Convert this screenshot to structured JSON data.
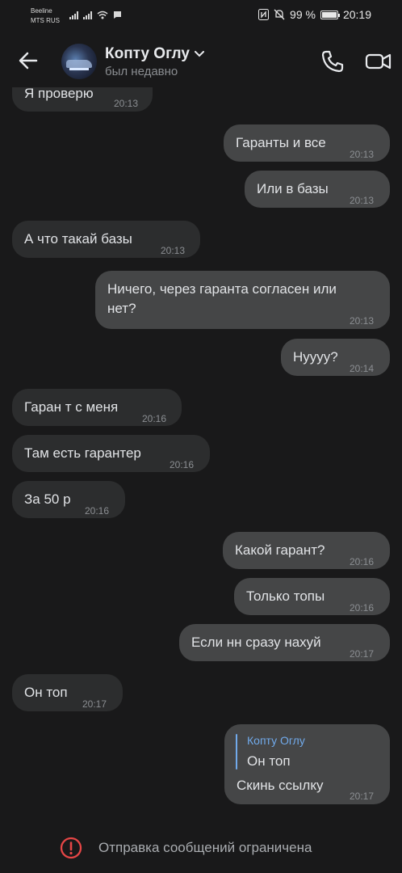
{
  "status_bar": {
    "carrier_1": "Beeline",
    "carrier_2": "MTS RUS",
    "battery": "99 %",
    "battery_level": 0.99,
    "time": "20:19"
  },
  "header": {
    "contact_name": "Копту Оглу",
    "last_seen": "был недавно"
  },
  "messages": [
    {
      "direction": "in",
      "text": "Я проверю",
      "time": "20:13"
    },
    {
      "direction": "out",
      "text": "Гаранты и все",
      "time": "20:13"
    },
    {
      "direction": "out",
      "text": "Или в базы",
      "time": "20:13"
    },
    {
      "direction": "in",
      "text": "А что такай базы",
      "time": "20:13"
    },
    {
      "direction": "out",
      "text_line_1": "Ничего, через гаранта согласен или",
      "text_line_2": "нет?",
      "time": "20:13"
    },
    {
      "direction": "out",
      "text": "Нуууу?",
      "time": "20:14"
    },
    {
      "direction": "in",
      "text": "Гаран т с меня",
      "time": "20:16"
    },
    {
      "direction": "in",
      "text": "Там есть гарантер",
      "time": "20:16"
    },
    {
      "direction": "in",
      "text": "За 50 р",
      "time": "20:16"
    },
    {
      "direction": "out",
      "text": "Какой гарант?",
      "time": "20:16"
    },
    {
      "direction": "out",
      "text": "Только топы",
      "time": "20:16"
    },
    {
      "direction": "out",
      "text": "Если нн сразу нахуй",
      "time": "20:17"
    },
    {
      "direction": "in",
      "text": "Он топ",
      "time": "20:17"
    },
    {
      "direction": "out",
      "reply_author": "Копту Оглу",
      "reply_text": "Он топ",
      "text": "Скинь ссылку",
      "time": "20:17"
    }
  ],
  "footer": {
    "restriction_text": "Отправка сообщений ограничена"
  },
  "colors": {
    "background": "#19191a",
    "incoming_bubble": "#2c2d2e",
    "outgoing_bubble": "#454647",
    "accent": "#71aaeb",
    "warning": "#e64646"
  }
}
